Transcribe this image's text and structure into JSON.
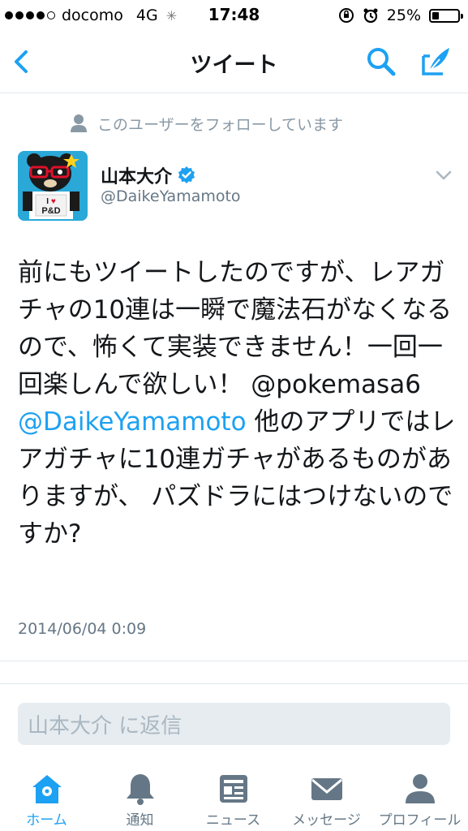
{
  "status_bar": {
    "carrier": "docomo",
    "network": "4G",
    "time": "17:48",
    "battery": "25%",
    "battery_level": 0.25
  },
  "nav": {
    "title": "ツイート"
  },
  "tweet": {
    "follow_notice": "このユーザーをフォローしています",
    "user_name": "山本大介",
    "user_handle": "@DaikeYamamoto",
    "text_1": "前にもツイートしたのですが、レアガチャの10連は一瞬で魔法石がなくなるので、怖くて実装できません！一回一回楽しんで欲しい！ @pokemasa6",
    "mention": "@DaikeYamamoto",
    "text_2": " 他のアプリではレアガチャに10連ガチャがあるものがありますが、 パズドラにはつけないのですか?",
    "timestamp": "2014/06/04 0:09",
    "avatar_text": "I ♥ P&D"
  },
  "reply": {
    "placeholder": "山本大介 に返信"
  },
  "tabs": [
    {
      "label": "ホーム",
      "icon": "home-icon",
      "active": true
    },
    {
      "label": "通知",
      "icon": "bell-icon",
      "active": false
    },
    {
      "label": "ニュース",
      "icon": "news-icon",
      "active": false
    },
    {
      "label": "メッセージ",
      "icon": "envelope-icon",
      "active": false
    },
    {
      "label": "プロフィール",
      "icon": "person-icon",
      "active": false
    }
  ],
  "colors": {
    "accent": "#1da1f2",
    "secondary_text": "#657786",
    "divider": "#e1e8ed",
    "reply_bg": "#e6ecf0"
  }
}
